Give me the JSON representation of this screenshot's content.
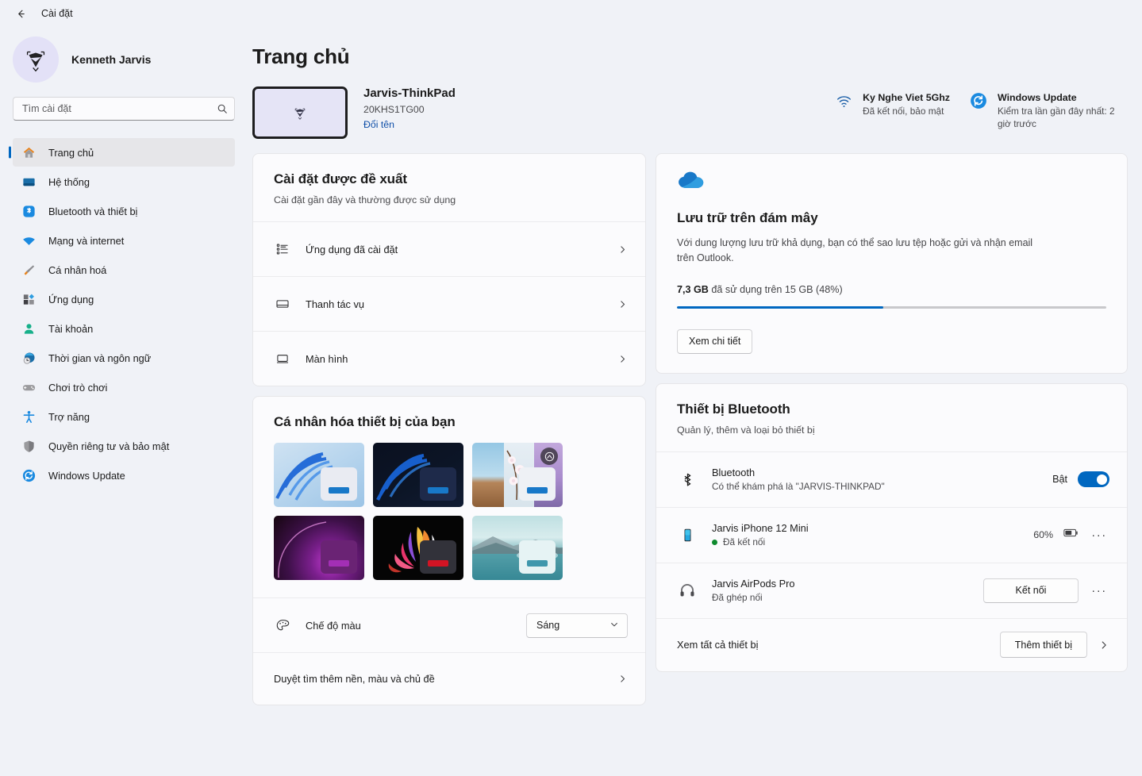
{
  "titlebar": {
    "back_icon": "back-arrow-icon",
    "title": "Cài đặt"
  },
  "sidebar": {
    "profile": {
      "name": "Kenneth Jarvis",
      "avatar_icon": "user-avatar-logo"
    },
    "search": {
      "placeholder": "Tìm cài đặt",
      "value": "",
      "icon": "search-icon"
    },
    "items": [
      {
        "label": "Trang chủ",
        "icon": "home-icon",
        "active": true
      },
      {
        "label": "Hệ thống",
        "icon": "system-monitor-icon",
        "active": false
      },
      {
        "label": "Bluetooth và thiết bị",
        "icon": "bluetooth-icon",
        "active": false
      },
      {
        "label": "Mạng và internet",
        "icon": "wifi-icon",
        "active": false
      },
      {
        "label": "Cá nhân hoá",
        "icon": "paintbrush-icon",
        "active": false
      },
      {
        "label": "Ứng dụng",
        "icon": "apps-icon",
        "active": false
      },
      {
        "label": "Tài khoản",
        "icon": "account-person-icon",
        "active": false
      },
      {
        "label": "Thời gian và ngôn ngữ",
        "icon": "clock-globe-icon",
        "active": false
      },
      {
        "label": "Chơi trò chơi",
        "icon": "gamepad-icon",
        "active": false
      },
      {
        "label": "Trợ năng",
        "icon": "accessibility-person-icon",
        "active": false
      },
      {
        "label": "Quyền riêng tư và bảo mật",
        "icon": "shield-icon",
        "active": false
      },
      {
        "label": "Windows Update",
        "icon": "update-sync-icon",
        "active": false
      }
    ]
  },
  "page": {
    "title": "Trang chủ"
  },
  "device": {
    "thumb_icon": "device-wallpaper-logo",
    "name": "Jarvis-ThinkPad",
    "serial": "20KHS1TG00",
    "rename_link": "Đổi tên"
  },
  "status": [
    {
      "icon": "wifi-icon",
      "title": "Ky Nghe Viet 5Ghz",
      "subtitle": "Đã kết nối, bảo mật"
    },
    {
      "icon": "update-sync-icon",
      "title": "Windows Update",
      "subtitle": "Kiểm tra lần gần đây nhất: 2 giờ trước"
    }
  ],
  "recommended": {
    "title": "Cài đặt được đề xuất",
    "subtitle": "Cài đặt gần đây và thường được sử dụng",
    "rows": [
      {
        "label": "Ứng dụng đã cài đặt",
        "icon": "app-list-icon"
      },
      {
        "label": "Thanh tác vụ",
        "icon": "taskbar-icon"
      },
      {
        "label": "Màn hình",
        "icon": "display-monitor-icon"
      }
    ]
  },
  "cloud": {
    "icon": "onedrive-cloud-icon",
    "title": "Lưu trữ trên đám mây",
    "description": "Với dung lượng lưu trữ khả dụng, bạn có thể sao lưu tệp hoặc gửi và nhận email trên Outlook.",
    "usage_value": "7,3 GB",
    "usage_rest": " đã sử dụng trên 15 GB (48%)",
    "percent": 48,
    "accent_color": "#0067c0",
    "button_label": "Xem chi tiết"
  },
  "personalize": {
    "title": "Cá nhân hóa thiết bị của bạn",
    "themes": [
      {
        "name": "theme-windows-light-bloom",
        "badge": false
      },
      {
        "name": "theme-windows-dark-bloom",
        "badge": false
      },
      {
        "name": "theme-nature-landscape-blossom",
        "badge": true
      },
      {
        "name": "theme-purple-glow",
        "badge": false
      },
      {
        "name": "theme-colorful-flower",
        "badge": false
      },
      {
        "name": "theme-mountain-lake",
        "badge": false
      }
    ],
    "color_mode": {
      "icon": "palette-icon",
      "label": "Chế độ màu",
      "value": "Sáng"
    },
    "browse_row": {
      "label": "Duyệt tìm thêm nền, màu và chủ đề"
    }
  },
  "bluetooth": {
    "title": "Thiết bị Bluetooth",
    "subtitle": "Quản lý, thêm và loại bỏ thiết bị",
    "toggle_row": {
      "icon": "bluetooth-icon",
      "name": "Bluetooth",
      "sub": "Có thể khám phá là \"JARVIS-THINKPAD\"",
      "state_label": "Bật",
      "on": true
    },
    "devices": [
      {
        "icon": "phone-icon",
        "name": "Jarvis iPhone 12 Mini",
        "status": "Đã kết nối",
        "connected": true,
        "battery": "60%",
        "battery_icon": "battery-icon",
        "more_icon": "more-options-icon"
      },
      {
        "icon": "headphones-icon",
        "name": "Jarvis AirPods Pro",
        "status": "Đã ghép nối",
        "connected": false,
        "action_label": "Kết nối",
        "more_icon": "more-options-icon"
      }
    ],
    "footer": {
      "link": "Xem tất cả thiết bị",
      "button": "Thêm thiết bị",
      "chevron_icon": "chevron-right-icon"
    }
  }
}
